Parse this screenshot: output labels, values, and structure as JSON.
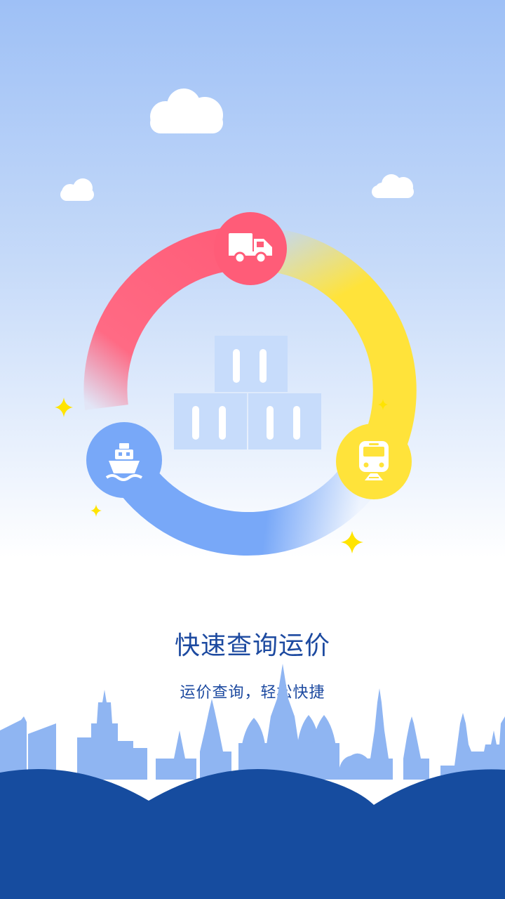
{
  "splash": {
    "title": "快速查询运价",
    "subtitle": "运价查询，轻松快捷"
  },
  "icons": {
    "transport_modes": [
      "truck-icon",
      "ship-icon",
      "train-icon"
    ],
    "center": "container-stack-icon",
    "decor": [
      "cloud-icon",
      "sparkle-icon",
      "city-skyline"
    ]
  },
  "colors": {
    "sky_top": "#9ec0f6",
    "ring_red": "#ff5c78",
    "ring_yellow": "#ffe33a",
    "ring_blue": "#78a8f8",
    "skyline": "#8fb5f2",
    "ground": "#164c9f",
    "text": "#1d4aa0",
    "sparkle": "#ffe400",
    "container": "#c7dcfb"
  }
}
